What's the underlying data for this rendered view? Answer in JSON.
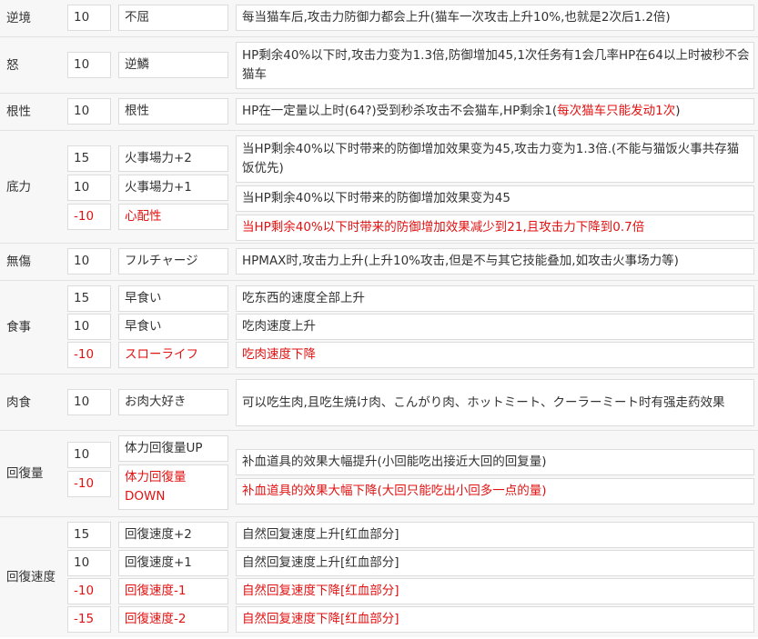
{
  "rows": [
    {
      "category": "逆境",
      "skills": [
        {
          "points": "10",
          "name": "不屈",
          "desc": "每当猫车后,攻击力防御力都会上升(猫车一次攻击上升10%,也就是2次后1.2倍)"
        }
      ]
    },
    {
      "category": "怒",
      "skills": [
        {
          "points": "10",
          "name": "逆鱗",
          "desc": "HP剩余40%以下时,攻击力变为1.3倍,防御增加45,1次任务有1会几率HP在64以上时被秒不会猫车"
        }
      ]
    },
    {
      "category": "根性",
      "skills": [
        {
          "points": "10",
          "name": "根性",
          "desc": "HP在一定量以上时(64?)受到秒杀攻击不会猫车,HP剩余1(",
          "desc_red": "每次猫车只能发动1次",
          "desc_tail": ")"
        }
      ]
    },
    {
      "category": "底力",
      "skills": [
        {
          "points": "15",
          "name": "火事場力+2",
          "desc": "当HP剩余40%以下时带来的防御增加效果变为45,攻击力变为1.3倍.(不能与猫饭火事共存猫饭优先)"
        },
        {
          "points": "10",
          "name": "火事場力+1",
          "desc": "当HP剩余40%以下时带来的防御增加效果变为45"
        },
        {
          "points": "-10",
          "name": "心配性",
          "desc": "当HP剩余40%以下时带来的防御增加效果减少到21,且攻击力下降到0.7倍"
        }
      ]
    },
    {
      "category": "無傷",
      "skills": [
        {
          "points": "10",
          "name": "フルチャージ",
          "desc": "HPMAX时,攻击力上升(上升10%攻击,但是不与其它技能叠加,如攻击火事场力等)"
        }
      ]
    },
    {
      "category": "食事",
      "skills": [
        {
          "points": "15",
          "name": "早食い",
          "desc": "吃东西的速度全部上升"
        },
        {
          "points": "10",
          "name": "早食い",
          "desc": "吃肉速度上升"
        },
        {
          "points": "-10",
          "name": "スローライフ",
          "desc": "吃肉速度下降"
        }
      ]
    },
    {
      "category": "肉食",
      "skills": [
        {
          "points": "10",
          "name": "お肉大好き",
          "desc": "可以吃生肉,且吃生焼け肉、こんがり肉、ホットミート、クーラーミート时有强走药效果"
        }
      ]
    },
    {
      "category": "回復量",
      "skills": [
        {
          "points": "10",
          "name": "体力回復量UP",
          "desc": "补血道具的效果大幅提升(小回能吃出接近大回的回复量)"
        },
        {
          "points": "-10",
          "name": "体力回復量DOWN",
          "desc": "补血道具的效果大幅下降(大回只能吃出小回多一点的量)"
        }
      ]
    },
    {
      "category": "回復速度",
      "skills": [
        {
          "points": "15",
          "name": "回復速度+2",
          "desc": "自然回复速度上升[红血部分]"
        },
        {
          "points": "10",
          "name": "回復速度+1",
          "desc": "自然回复速度上升[红血部分]"
        },
        {
          "points": "-10",
          "name": "回復速度-1",
          "desc": "自然回复速度下降[红血部分]"
        },
        {
          "points": "-15",
          "name": "回復速度-2",
          "desc": "自然回复速度下降[红血部分]"
        }
      ]
    }
  ],
  "colors": {
    "negative": "#e21212",
    "text": "#333333",
    "row_bg": "#f7f7f7",
    "cell_bg": "#ffffff",
    "border": "#dcdcdc"
  }
}
